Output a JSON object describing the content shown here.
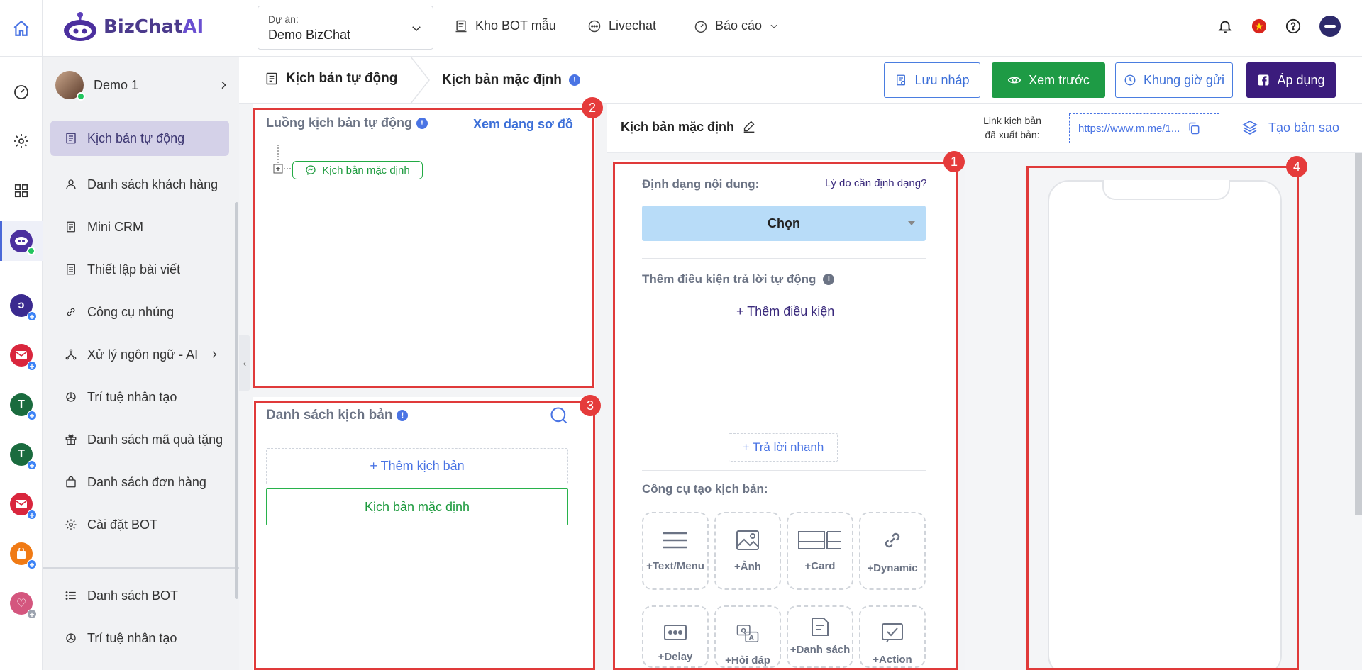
{
  "topbar": {
    "logo": {
      "biz": "BizChat",
      "ai": "AI"
    },
    "project_label": "Dự án:",
    "project_value": "Demo BizChat",
    "nav": [
      {
        "label": "Kho BOT mẫu",
        "icon": "template-icon"
      },
      {
        "label": "Livechat",
        "icon": "chat-icon"
      },
      {
        "label": "Báo cáo",
        "icon": "report-icon"
      }
    ]
  },
  "account": {
    "name": "Demo 1"
  },
  "sidebar": {
    "items": [
      {
        "label": "Kịch bản tự động",
        "icon": "script-icon"
      },
      {
        "label": "Danh sách khách hàng",
        "icon": "user-icon"
      },
      {
        "label": "Mini CRM",
        "icon": "crm-icon"
      },
      {
        "label": "Thiết lập bài viết",
        "icon": "post-icon"
      },
      {
        "label": "Công cụ nhúng",
        "icon": "link-icon"
      },
      {
        "label": "Xử lý ngôn ngữ - AI",
        "icon": "nlp-icon"
      },
      {
        "label": "Trí tuệ nhân tạo",
        "icon": "openai-icon"
      },
      {
        "label": "Danh sách mã quà tặng",
        "icon": "gift-icon"
      },
      {
        "label": "Danh sách đơn hàng",
        "icon": "bag-icon"
      },
      {
        "label": "Cài đặt BOT",
        "icon": "gear-icon"
      }
    ],
    "bottom_items": [
      {
        "label": "Danh sách BOT",
        "icon": "list-icon"
      },
      {
        "label": "Trí tuệ nhân tạo",
        "icon": "openai-icon"
      }
    ]
  },
  "header": {
    "crumb1": "Kịch bản tự động",
    "crumb2": "Kịch bản mặc định",
    "buttons": {
      "draft": "Lưu nháp",
      "preview": "Xem trước",
      "schedule": "Khung giờ gửi",
      "apply": "Áp dụng"
    }
  },
  "flow_panel": {
    "title": "Luồng kịch bản tự động",
    "diagram_link": "Xem dạng sơ đồ",
    "node": "Kịch bản mặc định",
    "badge": "2"
  },
  "list_panel": {
    "title": "Danh sách kịch bản",
    "add": "+ Thêm kịch bản",
    "items": [
      "Kịch bản mặc định"
    ],
    "badge": "3"
  },
  "editor": {
    "name": "Kịch bản mặc định",
    "link_label_1": "Link kịch bản",
    "link_label_2": "đã xuất bản:",
    "link_value": "https://www.m.me/1...",
    "copy_btn": "Tạo bản sao",
    "format_label": "Định dạng nội dung:",
    "why_link": "Lý do cần định dạng?",
    "select": "Chọn",
    "condition_label": "Thêm điều kiện trả lời tự động",
    "add_condition": "+ Thêm điều kiện",
    "quick_reply": "+ Trả lời nhanh",
    "tools_label": "Công cụ tạo kịch bản:",
    "tools": [
      {
        "label": "+Text/Menu",
        "icon": "menu-lines-icon"
      },
      {
        "label": "+Ảnh",
        "icon": "image-icon"
      },
      {
        "label": "+Card",
        "icon": "card-icon"
      },
      {
        "label": "+Dynamic",
        "icon": "link-chain-icon"
      },
      {
        "label": "+Delay",
        "icon": "delay-icon"
      },
      {
        "label": "+Hỏi đáp",
        "icon": "qa-icon"
      },
      {
        "label": "+Danh sách",
        "icon": "form-icon"
      },
      {
        "label": "+Action",
        "icon": "check-icon"
      }
    ],
    "badge": "1"
  },
  "preview": {
    "badge": "4"
  },
  "colors": {
    "accent": "#3c6fd8",
    "green": "#1e9b45",
    "purple": "#3b1c7c",
    "highlight": "#e03a3a"
  }
}
